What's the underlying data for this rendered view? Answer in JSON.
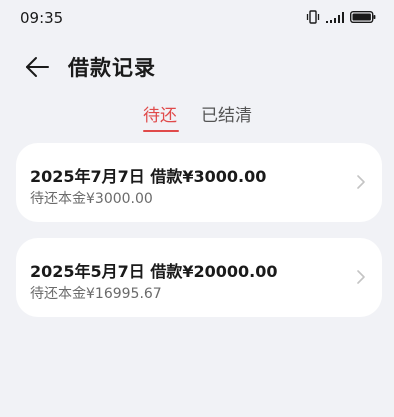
{
  "status_bar": {
    "time": "09:35",
    "icons": [
      "vibrate-icon",
      "signal-icon",
      "battery-icon"
    ]
  },
  "header": {
    "back_icon": "arrow-left-icon",
    "title": "借款记录"
  },
  "tabs": [
    {
      "label": "待还",
      "active": true
    },
    {
      "label": "已结清",
      "active": false
    }
  ],
  "records": [
    {
      "title": "2025年7月7日 借款¥3000.00",
      "subtitle": "待还本金¥3000.00"
    },
    {
      "title": "2025年5月7日 借款¥20000.00",
      "subtitle": "待还本金¥16995.67"
    }
  ],
  "colors": {
    "accent": "#e04a4a",
    "background": "#f1f2f6",
    "card": "#ffffff"
  }
}
